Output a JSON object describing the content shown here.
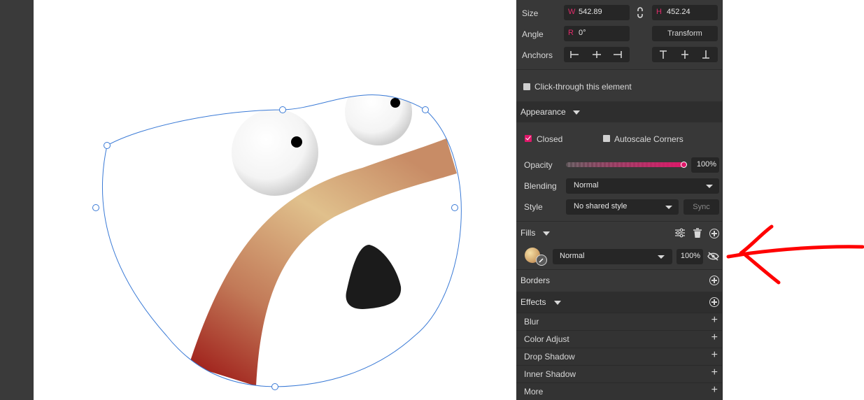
{
  "colors": {
    "accent": "#e0186a",
    "panel_bg": "#383838",
    "field_bg": "#262626",
    "selection": "#3a7ad6",
    "annotation": "#ff0000"
  },
  "geometry": {
    "size_label": "Size",
    "width_prefix": "W",
    "width_value": "542.89",
    "height_prefix": "H",
    "height_value": "452.24",
    "angle_label": "Angle",
    "angle_prefix": "R",
    "angle_value": "0°",
    "transform_button": "Transform",
    "anchors_label": "Anchors",
    "aspect_lock_icon": "link-icon",
    "anchor_icons": [
      "anchor-left-icon",
      "anchor-center-horizontal-icon",
      "anchor-right-icon",
      "anchor-top-icon",
      "anchor-center-vertical-icon",
      "anchor-bottom-icon"
    ]
  },
  "click_through": {
    "label": "Click-through this element",
    "checked": false
  },
  "appearance": {
    "title": "Appearance",
    "closed_label": "Closed",
    "closed_checked": true,
    "autoscale_label": "Autoscale Corners",
    "autoscale_checked": false,
    "opacity_label": "Opacity",
    "opacity_value": "100%",
    "opacity_level": 1.0,
    "blending_label": "Blending",
    "blending_value": "Normal",
    "style_label": "Style",
    "style_value": "No shared style",
    "sync_button": "Sync"
  },
  "fills": {
    "title": "Fills",
    "icons": [
      "fill-options-icon",
      "trash-icon",
      "add-circle-icon"
    ],
    "items": [
      {
        "blend": "Normal",
        "opacity": "100%",
        "swatch_icon": "gradient-swatch-icon",
        "visibility_icon": "eye-slash-icon"
      }
    ]
  },
  "borders": {
    "title": "Borders"
  },
  "effects": {
    "title": "Effects",
    "items": [
      "Blur",
      "Color Adjust",
      "Drop Shadow",
      "Inner Shadow",
      "More"
    ]
  },
  "annotation": {
    "icon": "red-arrow-annotation"
  }
}
